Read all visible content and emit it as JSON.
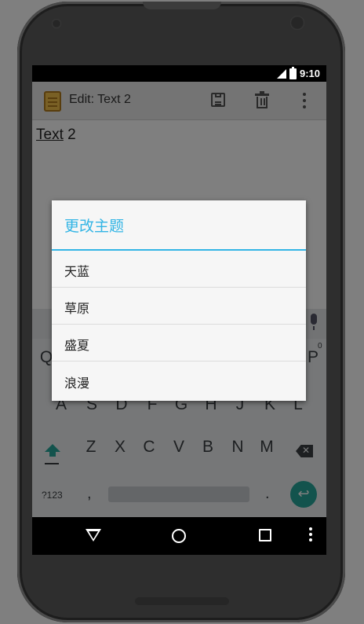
{
  "status_bar": {
    "time": "9:10"
  },
  "action_bar": {
    "title": "Edit: Text 2",
    "icons": [
      "app-note-icon",
      "save-icon",
      "delete-icon",
      "overflow-menu-icon"
    ]
  },
  "editor": {
    "word_underlined": "Text",
    "rest": " 2"
  },
  "keyboard": {
    "row_top_left": "Q",
    "row_top_right": "P",
    "row_top_hint": "0",
    "row_mid": [
      "A",
      "S",
      "D",
      "F",
      "G",
      "H",
      "J",
      "K",
      "L"
    ],
    "row_bottom": [
      "Z",
      "X",
      "C",
      "V",
      "B",
      "N",
      "M"
    ],
    "symbols_label": "?123",
    "comma": ",",
    "period": ".",
    "enter_glyph": "↩"
  },
  "dialog": {
    "title": "更改主题",
    "items": [
      {
        "label": "天蓝"
      },
      {
        "label": "草原"
      },
      {
        "label": "盛夏"
      },
      {
        "label": "浪漫"
      }
    ]
  },
  "colors": {
    "accent": "#33b5e5",
    "keyboard_accent": "#26a69a"
  }
}
